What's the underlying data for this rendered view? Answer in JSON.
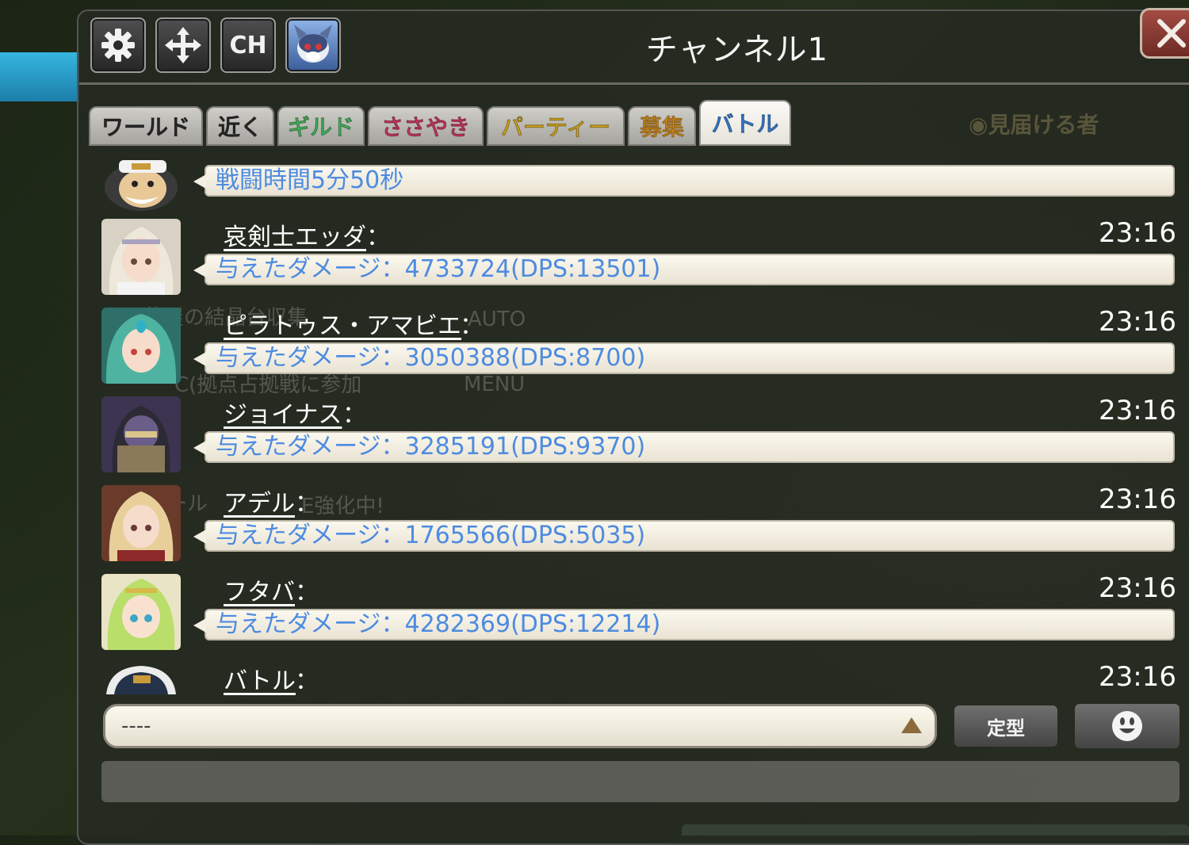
{
  "header": {
    "title": "チャンネル1",
    "settings_icon": "gear-icon",
    "move_icon": "move-arrows-icon",
    "channel_label": "CH",
    "avatar_icon": "mascot-avatar-icon",
    "close_icon": "close-x-icon"
  },
  "tabs": [
    {
      "label": "ワールド",
      "color": "#2e2e2e",
      "active": false
    },
    {
      "label": "近く",
      "color": "#2e2e2e",
      "active": false
    },
    {
      "label": "ギルド",
      "color": "#4fc96a",
      "active": false
    },
    {
      "label": "ささやき",
      "color": "#e0406a",
      "active": false
    },
    {
      "label": "パーティー",
      "color": "#e8b824",
      "active": false
    },
    {
      "label": "募集",
      "color": "#f0a020",
      "active": false
    },
    {
      "label": "バトル",
      "color": "#3c8ae6",
      "active": true
    }
  ],
  "watcher_label": "見届ける者",
  "messages": [
    {
      "name": "",
      "text": "戦闘時間5分50秒",
      "time": "",
      "avatar": "captain-avatar"
    },
    {
      "name": "哀剣士エッダ",
      "text": "与えたダメージ：4733724(DPS:13501)",
      "time": "23:16",
      "avatar": "white-hair-girl-avatar"
    },
    {
      "name": "ピラトゥス・アマビエ",
      "text": "与えたダメージ：3050388(DPS:8700)",
      "time": "23:16",
      "avatar": "teal-hair-girl-avatar"
    },
    {
      "name": "ジョイナス",
      "text": "与えたダメージ：3285191(DPS:9370)",
      "time": "23:16",
      "avatar": "armored-knight-avatar"
    },
    {
      "name": "アデル",
      "text": "与えたダメージ：1765566(DPS:5035)",
      "time": "23:16",
      "avatar": "blonde-girl-avatar"
    },
    {
      "name": "フタバ",
      "text": "与えたダメージ：4282369(DPS:12214)",
      "time": "23:16",
      "avatar": "green-hair-girl-avatar"
    },
    {
      "name": "バトル",
      "text": "",
      "time": "23:16",
      "avatar": "captain-hat-avatar"
    }
  ],
  "colon": "：",
  "input": {
    "value": "----",
    "send_icon": "triangle-up-icon"
  },
  "template_button": "定型",
  "emoji_icon": "smiley-face-icon",
  "colors": {
    "accent_text": "#4d8be0",
    "bubble_bg": "#f7f3e8"
  }
}
